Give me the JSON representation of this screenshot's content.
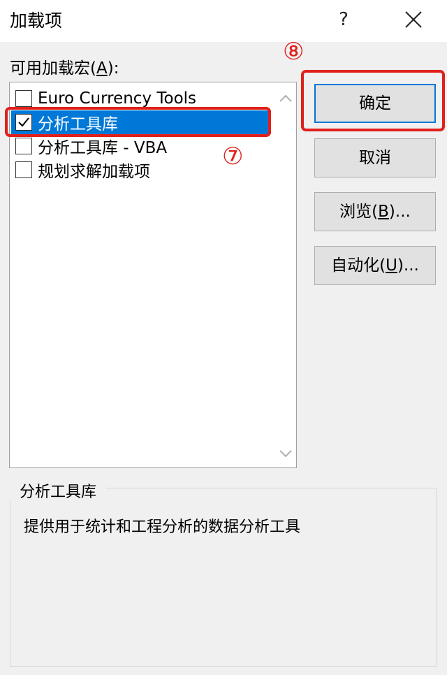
{
  "window": {
    "title": "加载项",
    "help_label": "?"
  },
  "list": {
    "label_prefix": "可用加载宏(",
    "label_accel": "A",
    "label_suffix": "):",
    "items": [
      {
        "label": "Euro Currency Tools",
        "checked": false,
        "selected": false
      },
      {
        "label": "分析工具库",
        "checked": true,
        "selected": true
      },
      {
        "label": "分析工具库 - VBA",
        "checked": false,
        "selected": false
      },
      {
        "label": "规划求解加载项",
        "checked": false,
        "selected": false
      }
    ]
  },
  "buttons": {
    "ok": "确定",
    "cancel": "取消",
    "browse_prefix": "浏览(",
    "browse_accel": "B",
    "browse_suffix": ")...",
    "automation_prefix": "自动化(",
    "automation_accel": "U",
    "automation_suffix": ")..."
  },
  "description": {
    "title": "分析工具库",
    "text": "提供用于统计和工程分析的数据分析工具"
  },
  "annotations": {
    "step7": "⑦",
    "step8": "⑧",
    "color": "#e0201b"
  }
}
